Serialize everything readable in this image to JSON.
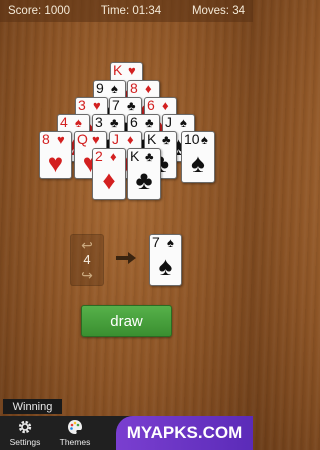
{
  "status": {
    "score_label": "Score: 1000",
    "time_label": "Time: 01:34",
    "moves_label": "Moves: 34"
  },
  "pyramid": {
    "row1": [
      {
        "rank": "K",
        "suit": "♥",
        "color": "red"
      }
    ],
    "row2": [
      {
        "rank": "9",
        "suit": "♠",
        "color": "black"
      },
      {
        "rank": "8",
        "suit": "♦",
        "color": "red"
      }
    ],
    "row3": [
      {
        "rank": "3",
        "suit": "♥",
        "color": "red"
      },
      {
        "rank": "7",
        "suit": "♣",
        "color": "black"
      },
      {
        "rank": "6",
        "suit": "♦",
        "color": "red"
      }
    ],
    "row4": [
      {
        "rank": "4",
        "suit": "♠",
        "color": "red"
      },
      {
        "rank": "3",
        "suit": "♣",
        "color": "black"
      },
      {
        "rank": "6",
        "suit": "♣",
        "color": "black"
      },
      {
        "rank": "J",
        "suit": "♠",
        "color": "black"
      }
    ],
    "row5": [
      {
        "rank": "8",
        "suit": "♥",
        "color": "red"
      },
      {
        "rank": "Q",
        "suit": "♥",
        "color": "red"
      },
      {
        "rank": "J",
        "suit": "♦",
        "color": "red"
      },
      {
        "rank": "K",
        "suit": "♣",
        "color": "black"
      },
      {
        "rank": "10",
        "suit": "♠",
        "color": "black"
      }
    ],
    "row6": [
      {
        "rank": "2",
        "suit": "♦",
        "color": "red"
      },
      {
        "rank": "K",
        "suit": "♣",
        "color": "black"
      }
    ]
  },
  "waste_card": {
    "rank": "7",
    "suit": "♠",
    "color": "black"
  },
  "undo_count": "4",
  "draw_label": "draw",
  "winning_label": "Winning",
  "toolbar": {
    "settings_label": "Settings",
    "themes_label": "Themes"
  },
  "watermark_text": "MYAPKS.COM",
  "colors": {
    "red_suit": "#d32020",
    "black_suit": "#111111",
    "draw_button": "#46a03a",
    "felt_wood": "#8a5224"
  }
}
